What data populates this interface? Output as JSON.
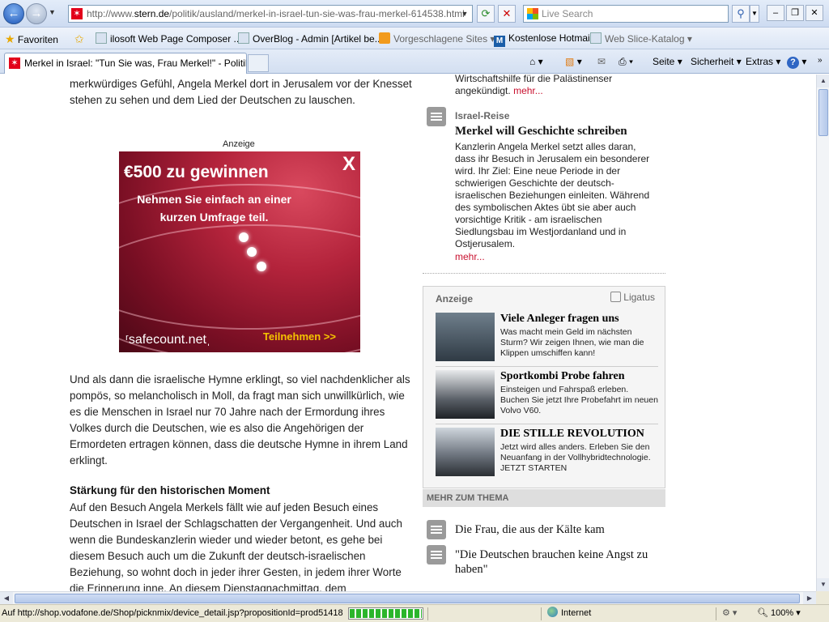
{
  "browser": {
    "address_url_pre": "http://www.",
    "address_url_domain": "stern.de",
    "address_url_post": "/politik/ausland/merkel-in-israel-tun-sie-was-frau-merkel-614538.html",
    "search_placeholder": "Live Search",
    "favorites_label": "Favoriten",
    "favorites_bar": [
      "ilosoft Web Page Composer ...",
      "OverBlog - Admin [Artikel be...",
      "Vorgeschlagene Sites",
      "Kostenlose Hotmail",
      "Web Slice-Katalog"
    ],
    "tab_title": "Merkel in Israel: \"Tun Sie was, Frau Merkel!\" - Politik | ...",
    "commands": [
      "Seite",
      "Sicherheit",
      "Extras"
    ]
  },
  "article": {
    "intro": "merkwürdiges Gefühl, Angela Merkel dort in Jerusalem vor der Knesset stehen zu sehen und dem Lied der Deutschen zu lauschen.",
    "ad_label": "Anzeige",
    "ad": {
      "headline": "€500 zu gewinnen",
      "sub": "Nehmen Sie einfach an einer kurzen Umfrage teil.",
      "brand": "ʳsafecount.netˌ",
      "cta": "Teilnehmen >>",
      "close": "X"
    },
    "para1": "Und als dann die israelische Hymne erklingt, so viel nachdenklicher als pompös, so melancholisch in Moll, da fragt man sich unwillkürlich, wie es die Menschen in Israel nur 70 Jahre nach der Ermordung ihres Volkes durch die Deutschen, wie es also die Angehörigen der Ermordeten ertragen können, dass die deutsche Hymne in ihrem Land erklingt.",
    "section_heading": "Stärkung für den historischen Moment",
    "para2": "Auf den Besuch Angela Merkels fällt wie auf jeden Besuch eines Deutschen in Israel der Schlagschatten der Vergangenheit. Und auch wenn die Bundeskanzlerin wieder und wieder betont, es gehe bei diesem Besuch auch um die Zukunft der deutsch-israelischen Beziehung, so wohnt doch in jeder ihrer Gesten, in jedem ihrer Worte die Erinnerung inne. An diesem Dienstagnachmittag, dem"
  },
  "sidebar": {
    "prev_text": "Wirtschaftshilfe für die Palästinenser angekündigt.",
    "more_label": "mehr...",
    "teaser": {
      "kicker": "Israel-Reise",
      "title": "Merkel will Geschichte schreiben",
      "body": "Kanzlerin Angela Merkel setzt alles daran, dass ihr Besuch in Jerusalem ein besonderer wird. Ihr Ziel: Eine neue Periode in der schwierigen Geschichte der deutsch-israelischen Beziehungen einleiten. Während des symbolischen Aktes übt sie aber auch vorsichtige Kritik - am israelischen Siedlungsbau im Westjordanland und in Ostjerusalem."
    },
    "ad_box": {
      "label": "Anzeige",
      "network": "Ligatus",
      "items": [
        {
          "title": "Viele Anleger fragen uns",
          "desc": "Was macht mein Geld im nächsten Sturm? Wir zeigen Ihnen, wie man die Klippen umschiffen kann!"
        },
        {
          "title": "Sportkombi Probe fahren",
          "desc": "Einsteigen und Fahrspaß erleben. Buchen Sie jetzt Ihre Probefahrt im neuen Volvo V60."
        },
        {
          "title": "DIE STILLE REVOLUTION",
          "desc": "Jetzt wird alles anders. Erleben Sie den Neuanfang in der Vollhybridtechnologie. JETZT STARTEN"
        }
      ]
    },
    "more_topic_label": "MEHR ZUM THEMA",
    "more_topic_links": [
      "Die Frau, die aus der Kälte kam",
      "\"Die Deutschen brauchen keine Angst zu haben\""
    ]
  },
  "status": {
    "text": "Auf http://shop.vodafone.de/Shop/picknmix/device_detail.jsp?propositionId=prod51418",
    "progress": 1.0,
    "zone": "Internet",
    "zoom": "100%"
  },
  "colors": {
    "link_red": "#c8102e",
    "stern_red": "#e2001a"
  }
}
